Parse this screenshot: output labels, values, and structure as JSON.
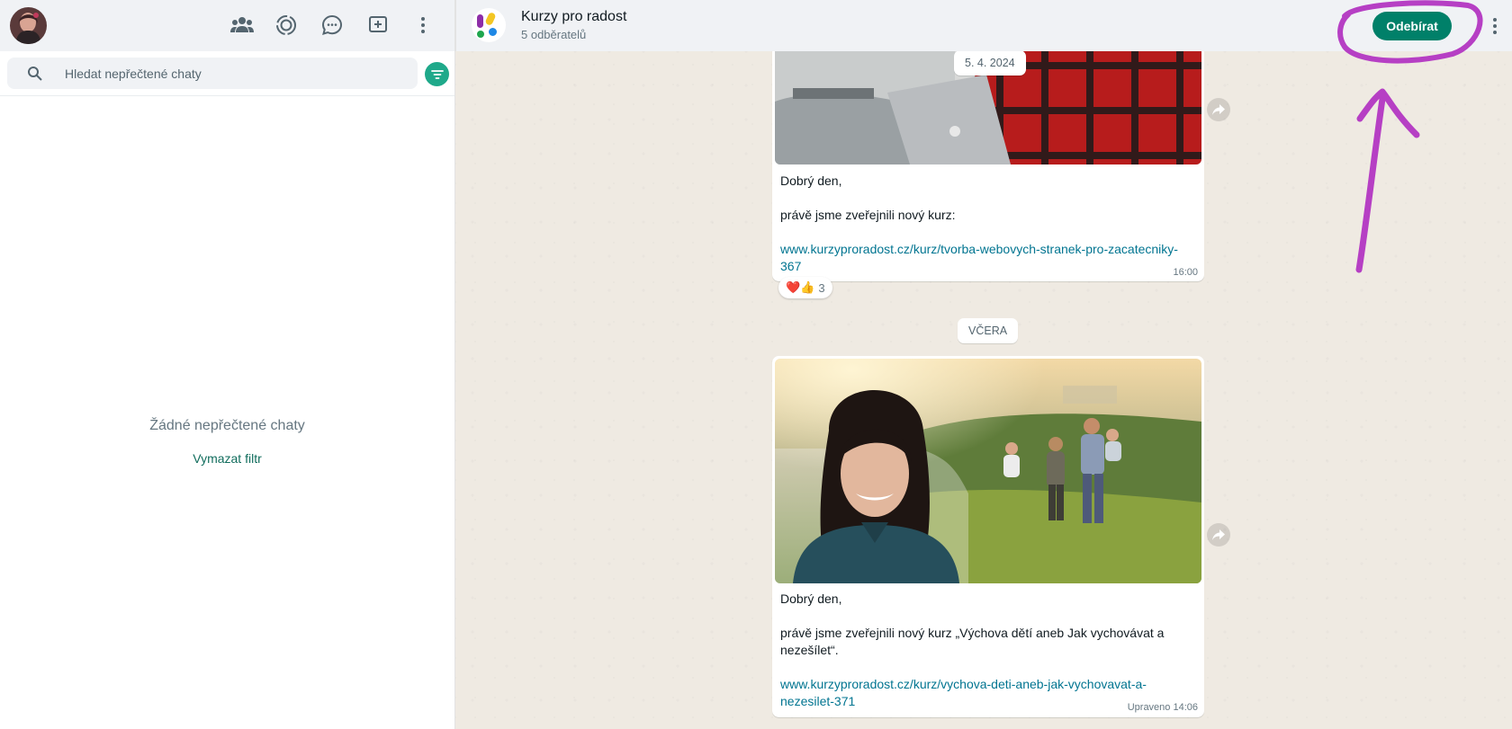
{
  "left_panel": {
    "search": {
      "placeholder": "Hledat nepřečtené chaty"
    },
    "empty_state": {
      "title": "Žádné nepřečtené chaty",
      "clear_filter": "Vymazat filtr"
    },
    "icons": [
      "communities-icon",
      "status-icon",
      "channels-icon",
      "new-chat-icon",
      "menu-icon"
    ]
  },
  "channel": {
    "name": "Kurzy pro radost",
    "subscribers": "5 odběratelů",
    "follow_label": "Odebírat"
  },
  "messages": [
    {
      "date": "5. 4. 2024",
      "greeting": "Dobrý den,",
      "body": "právě jsme zveřejnili nový kurz:",
      "link": "www.kurzyproradost.cz/kurz/tvorba-webovych-stranek-pro-zacatecniky-367",
      "time": "16:00",
      "reaction": {
        "emojis": "❤️👍",
        "count": "3"
      }
    },
    {
      "date": "VČERA",
      "greeting": "Dobrý den,",
      "body": "právě jsme zveřejnili nový kurz „Výchova dětí aneb Jak vychovávat a nezešílet“.",
      "link": "www.kurzyproradost.cz/kurz/vychova-deti-aneb-jak-vychovavat-a-nezesilet-371",
      "time": "Upraveno 14:06"
    }
  ],
  "colors": {
    "accent": "#008069",
    "filter": "#1fa98a",
    "annotation": "#b63fc4",
    "chat_bg": "#efeae2"
  }
}
